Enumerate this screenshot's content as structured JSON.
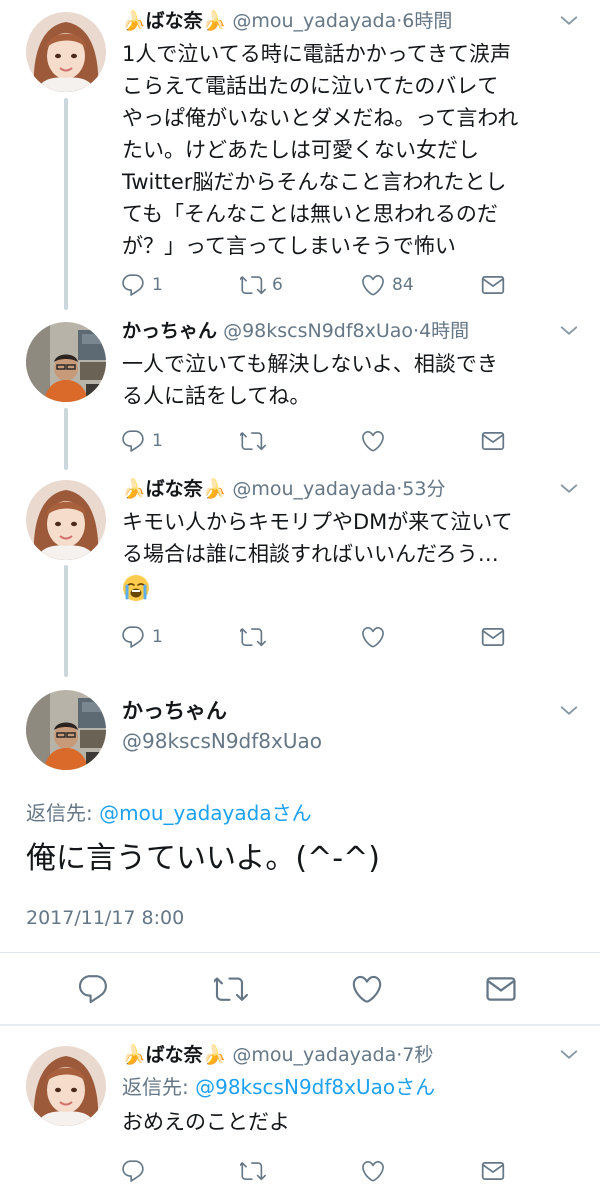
{
  "tweets": [
    {
      "name": "🍌ばな奈🍌",
      "handle": "@mou_yadayada",
      "time": "6時間",
      "text": "1人で泣いてる時に電話かかってきて涙声\nこらえて電話出たのに泣いてたのバレて\nやっぱ俺がいないとダメだね。って言われ\nたい。けどあたしは可愛くない女だし\nTwitter脳だからそんなこと言われたとし\nても「そんなことは無いと思われるのだ\nが？」って言ってしまいそうで怖い",
      "replies": "1",
      "retweets": "6",
      "likes": "84"
    },
    {
      "name": "かっちゃん",
      "handle": "@98kscsN9df8xUao",
      "time": "4時間",
      "text": "一人で泣いても解決しないよ、相談でき\nる人に話をしてね。",
      "replies": "1",
      "retweets": "",
      "likes": ""
    },
    {
      "name": "🍌ばな奈🍌",
      "handle": "@mou_yadayada",
      "time": "53分",
      "text": "キモい人からキモリプやDMが来て泣いて\nる場合は誰に相談すればいいんだろう…",
      "emoji": "loudly-crying-face",
      "replies": "1",
      "retweets": "",
      "likes": ""
    }
  ],
  "focused": {
    "name": "かっちゃん",
    "handle": "@98kscsN9df8xUao",
    "reply_prefix": "返信先: ",
    "reply_to": "@mou_yadayadaさん",
    "text": "俺に言うていいよ。(^-^)",
    "date": "2017/11/17 8:00"
  },
  "last": {
    "name": "🍌ばな奈🍌",
    "handle": "@mou_yadayada",
    "time": "7秒",
    "reply_prefix": "返信先: ",
    "reply_to": "@98kscsN9df8xUaoさん",
    "text": "おめえのことだよ"
  },
  "sep": "·",
  "icons": {
    "reply": "reply-icon",
    "retweet": "retweet-icon",
    "like": "heart-icon",
    "dm": "envelope-icon",
    "more": "chevron-down-icon"
  },
  "colors": {
    "text": "#14171a",
    "secondary": "#657786",
    "link": "#1da1f2",
    "thread": "#ccd6dd"
  }
}
